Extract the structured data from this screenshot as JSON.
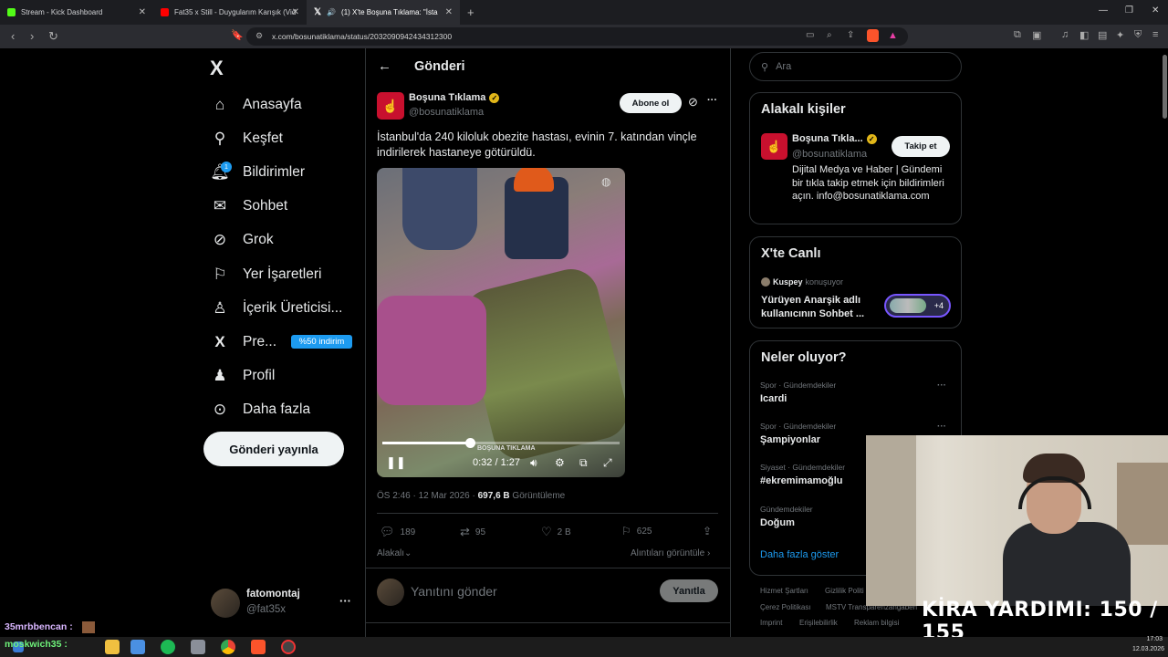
{
  "browser": {
    "tabs": [
      {
        "title": "Stream - Kick Dashboard",
        "color": "#53fc18"
      },
      {
        "title": "Fat35 x Still - Duygularım Karışık (Vid",
        "color": "#ff0000"
      },
      {
        "title": "(1) X'te Boşuna Tıklama: \"İsta",
        "color": "#ffffff"
      }
    ],
    "url": "x.com/bosunatiklama/status/2032090942434312300"
  },
  "nav": {
    "logo": "X",
    "items": [
      {
        "label": "Anasayfa",
        "icon": "home-icon"
      },
      {
        "label": "Keşfet",
        "icon": "search-icon"
      },
      {
        "label": "Bildirimler",
        "icon": "bell-icon"
      },
      {
        "label": "Sohbet",
        "icon": "mail-icon"
      },
      {
        "label": "Grok",
        "icon": "grok-icon"
      },
      {
        "label": "Yer İşaretleri",
        "icon": "bookmark-icon"
      },
      {
        "label": "İçerik Üreticisi...",
        "icon": "creator-icon"
      },
      {
        "label": "Pre...",
        "icon": "x-icon"
      },
      {
        "label": "Profil",
        "icon": "person-icon"
      },
      {
        "label": "Daha fazla",
        "icon": "more-circle-icon"
      }
    ],
    "notification_count": "1",
    "premium_badge": "%50 indirim",
    "post_button": "Gönderi yayınla",
    "account": {
      "name": "fatomontaj",
      "handle": "@fat35x"
    }
  },
  "post": {
    "header_title": "Gönderi",
    "author_name": "Boşuna Tıklama",
    "author_handle": "@bosunatiklama",
    "subscribe_label": "Abone ol",
    "text": "İstanbul'da 240 kiloluk obezite hastası, evinin 7. katından vinçle indirilerek hastaneye götürüldü.",
    "video": {
      "time": "0:32 / 1:27",
      "progress": 0.37,
      "watermark": "BOŞUNA TIKLAMA"
    },
    "meta_time": "ÖS 2:46 · 12 Mar 2026 · ",
    "views_count": "697,6 B",
    "views_label": " Görüntüleme",
    "replies": "189",
    "reposts": "95",
    "likes": "2 B",
    "bookmarks": "625",
    "relevant_label": "Alakalı",
    "quotes_label": "Alıntıları görüntüle",
    "reply_placeholder": "Yanıtını gönder",
    "reply_button": "Yanıtla"
  },
  "sidebar": {
    "search_placeholder": "Ara",
    "related_title": "Alakalı kişiler",
    "related_name": "Boşuna Tıkla...",
    "related_handle": "@bosunatiklama",
    "follow_label": "Takip et",
    "related_bio": "Dijital Medya ve Haber | Gündemi bir tıkla takip etmek için bildirimleri açın. info@bosunatiklama.com",
    "live_title": "X'te Canlı",
    "live_host": "Kuspey",
    "live_host_suffix": " konuşuyor",
    "live_text": "Yürüyen Anarşik adlı kullanıcının Sohbet ...",
    "live_count": "+4",
    "trends_title": "Neler oluyor?",
    "trends": [
      {
        "category": "Spor · Gündemdekiler",
        "name": "Icardi"
      },
      {
        "category": "Spor · Gündemdekiler",
        "name": "Şampiyonlar"
      },
      {
        "category": "Siyaset · Gündemdekiler",
        "name": "#ekremimamoğlu"
      },
      {
        "category": "Gündemdekiler",
        "name": "Doğum"
      }
    ],
    "show_more": "Daha fazla göster",
    "footer": [
      "Hizmet Şartları",
      "Gizlilik Politi",
      "Çerez Politikası",
      "MSTV Transparenzangaben",
      "Imprint",
      "Erişilebilirlik",
      "Reklam bilgisi"
    ]
  },
  "stream": {
    "overlay_text": "KİRA YARDIMI: 150 / 155",
    "chat1_user": "35mrbbencan :",
    "chat2_user": "moskwich35 :"
  },
  "taskbar": {
    "time": "17:03",
    "date": "12.03.2026"
  }
}
